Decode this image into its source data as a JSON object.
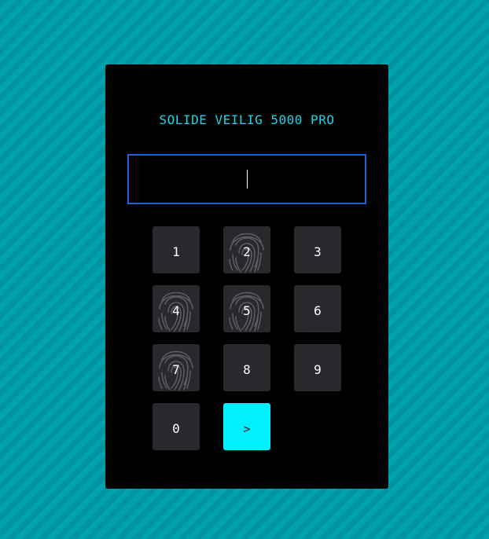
{
  "app": {
    "title": "SOLIDE VEILIG 5000 PRO"
  },
  "display": {
    "value": ""
  },
  "keypad": {
    "keys": [
      {
        "label": "1",
        "smudged": false
      },
      {
        "label": "2",
        "smudged": true
      },
      {
        "label": "3",
        "smudged": false
      },
      {
        "label": "4",
        "smudged": true
      },
      {
        "label": "5",
        "smudged": true
      },
      {
        "label": "6",
        "smudged": false
      },
      {
        "label": "7",
        "smudged": true
      },
      {
        "label": "8",
        "smudged": false
      },
      {
        "label": "9",
        "smudged": false
      },
      {
        "label": "0",
        "smudged": false
      }
    ],
    "enter_label": ">"
  },
  "colors": {
    "background": "#009fa8",
    "panel": "#000000",
    "title": "#1fd4e4",
    "display_border": "#1a66d8",
    "key": "#29292d",
    "enter_key": "#00f0ff"
  },
  "icons": {
    "fingerprint": "fingerprint-icon",
    "enter": "chevron-right"
  }
}
